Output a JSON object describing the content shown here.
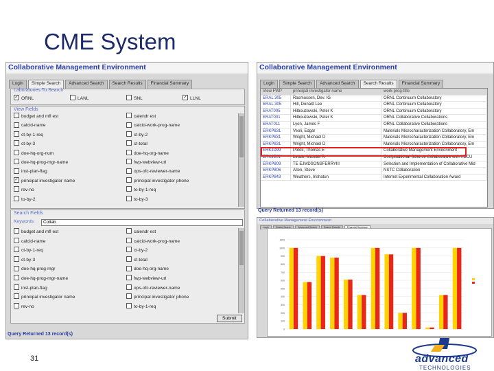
{
  "slide": {
    "title": "CME System",
    "page_number": "31"
  },
  "logo": {
    "line1": "advanced",
    "line2": "TECHNOLOGIES"
  },
  "left_window": {
    "title": "Collaborative Management Environment",
    "tabs": [
      "Login",
      "Simple Search",
      "Advanced Search",
      "Search Results",
      "Financial Summary"
    ],
    "labs_label": "Laboratories To Search",
    "labs": [
      {
        "label": "ORNL",
        "checked": true
      },
      {
        "label": "LANL",
        "checked": false
      },
      {
        "label": "SNL",
        "checked": false
      },
      {
        "label": "LLNL",
        "checked": true
      }
    ],
    "view_fields_label": "View Fields",
    "view_fields": [
      {
        "label": "budget and mfl est",
        "checked": false
      },
      {
        "label": "calendr est",
        "checked": false
      },
      {
        "label": "calcid-name",
        "checked": false
      },
      {
        "label": "calcid-work-prog-name",
        "checked": false
      },
      {
        "label": "ct-by-1-req",
        "checked": false
      },
      {
        "label": "ct-by-2",
        "checked": false
      },
      {
        "label": "ct-by-3",
        "checked": false
      },
      {
        "label": "ct-total",
        "checked": false
      },
      {
        "label": "doe-hq-org-num",
        "checked": false
      },
      {
        "label": "doe-hq-org-name",
        "checked": false
      },
      {
        "label": "doe-hq-prog-mgr-name",
        "checked": false
      },
      {
        "label": "fwp-webview-url",
        "checked": false
      },
      {
        "label": "inst-plan-flag",
        "checked": false
      },
      {
        "label": "ops-ofc-reviewer-name",
        "checked": false
      },
      {
        "label": "principal investigator name",
        "checked": true
      },
      {
        "label": "principal investigator phone",
        "checked": false
      },
      {
        "label": "rev-no",
        "checked": false
      },
      {
        "label": "to-by-1-req",
        "checked": false
      },
      {
        "label": "to-by-2",
        "checked": false
      },
      {
        "label": "to-by-3",
        "checked": false
      }
    ],
    "search_fields_label": "Search Fields",
    "keywords_label": "Keywords:",
    "keywords_value": "Collab",
    "search_fields": [
      {
        "label": "budget and mfl est",
        "checked": false
      },
      {
        "label": "calendr est",
        "checked": false
      },
      {
        "label": "calcid-name",
        "checked": false
      },
      {
        "label": "calcid-work-prog-name",
        "checked": false
      },
      {
        "label": "ct-by-1-req",
        "checked": false
      },
      {
        "label": "ct-by-2",
        "checked": false
      },
      {
        "label": "ct-by-3",
        "checked": false
      },
      {
        "label": "ct-total",
        "checked": false
      },
      {
        "label": "doe-hq-prog-mgr",
        "checked": false
      },
      {
        "label": "doe-hq-org-name",
        "checked": false
      },
      {
        "label": "doe-hq-prog-mgr-name",
        "checked": false
      },
      {
        "label": "fwp-webview-url",
        "checked": false
      },
      {
        "label": "inst-plan-flag",
        "checked": false
      },
      {
        "label": "ops-ofc-reviewer-name",
        "checked": false
      },
      {
        "label": "principal investigator name",
        "checked": false
      },
      {
        "label": "principal investigator phone",
        "checked": false
      },
      {
        "label": "rev-no",
        "checked": false
      },
      {
        "label": "to-by-1-req",
        "checked": false
      }
    ],
    "submit_label": "Submit",
    "status": "Query Returned 13 record(s)"
  },
  "right_window": {
    "title": "Collaborative Management Environment",
    "tabs": [
      "Login",
      "Simple Search",
      "Advanced Search",
      "Search Results",
      "Financial Summary"
    ],
    "columns": [
      "View FWP",
      "principal investigator name",
      "work-prog-title"
    ],
    "rows": [
      {
        "id": "ERAL 305",
        "pi": "Rasmussen, Dev. IG",
        "title": "ORNL Continuum Collaboratory"
      },
      {
        "id": "ERAL 305",
        "pi": "Hill, Donald Lee",
        "title": "ORNL Continuum Collaboratory"
      },
      {
        "id": "ERAT005",
        "pi": "Hilbouzewski, Peter K",
        "title": "ORNL Continuum Collaboratory"
      },
      {
        "id": "ERAT001",
        "pi": "Hilbouzewski, Peter K",
        "title": "ORNL Collaborative Collaborations"
      },
      {
        "id": "ERAT011",
        "pi": "Lyon, James F",
        "title": "ORNL Collaborative Collaborations"
      },
      {
        "id": "ERKP831",
        "pi": "Veoli, Edgar",
        "title": "Materials Microcharacterization Collaboratory, Em"
      },
      {
        "id": "ERKP831",
        "pi": "Wright, Michael D",
        "title": "Materials Microcharacterization Collaboratory, Em"
      },
      {
        "id": "ERKP831",
        "pi": "Wright, Michael D",
        "title": "Materials Microcharacterization Collaboratory, Em"
      },
      {
        "id": "ERKJD99",
        "pi": "Potok, Thomas E",
        "title": "Collaborative Management Environment"
      },
      {
        "id": "ERKJE01",
        "pi": "Leuze, Michael R",
        "title": "Computational Science Collaborative with HBCU"
      },
      {
        "id": "ERKP809",
        "pi": "TE EJMDSONSFERRYIII",
        "title": "Selection and Implementation of Collaborative Mid"
      },
      {
        "id": "ERKP806",
        "pi": "Allen, Steve",
        "title": "NSTC Collaboration"
      },
      {
        "id": "ERKP843",
        "pi": "Weathers, Irishatun",
        "title": "Internet Experimental Collaboration Award"
      }
    ],
    "highlight_row_index": 8,
    "status": "Query Returned 13 record(s)"
  },
  "summary_window": {
    "title": "Collaborative Management Environment",
    "tabs": [
      "Login",
      "Simple Search",
      "Advanced Search",
      "Search Results",
      "Financial Summary"
    ]
  },
  "chart_data": {
    "type": "bar",
    "categories": [
      "1",
      "2",
      "3",
      "4",
      "5",
      "6",
      "7",
      "8",
      "9",
      "10",
      "11",
      "12",
      "13"
    ],
    "series": [
      {
        "values": [
          1000,
          580,
          900,
          880,
          610,
          420,
          1000,
          920,
          200,
          1000,
          20,
          420,
          1000
        ]
      },
      {
        "values": [
          1000,
          580,
          900,
          880,
          610,
          420,
          1000,
          920,
          200,
          1000,
          20,
          420,
          1000
        ]
      }
    ],
    "ylim": [
      0,
      1100
    ],
    "yticks": [
      0,
      100,
      200,
      300,
      400,
      500,
      600,
      700,
      800,
      900,
      1000,
      1100
    ],
    "colors": [
      "#ffd200",
      "#e8261a"
    ],
    "legend_placement": "right"
  }
}
